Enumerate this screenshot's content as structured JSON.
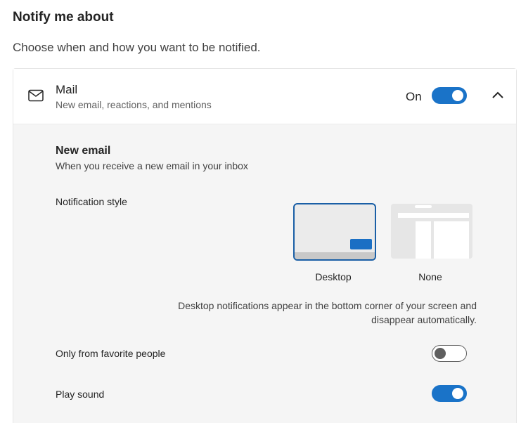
{
  "page": {
    "title": "Notify me about",
    "subtitle": "Choose when and how you want to be notified."
  },
  "mail": {
    "icon": "mail-icon",
    "title": "Mail",
    "description": "New email, reactions, and mentions",
    "status_label": "On",
    "enabled": true,
    "expand_icon": "chevron-up-icon"
  },
  "new_email": {
    "title": "New email",
    "description": "When you receive a new email in your inbox",
    "notification_style_label": "Notification style",
    "options": [
      {
        "label": "Desktop",
        "selected": true
      },
      {
        "label": "None",
        "selected": false
      }
    ],
    "info": "Desktop notifications appear in the bottom corner of your screen and disappear automatically."
  },
  "settings": [
    {
      "label": "Only from favorite people",
      "enabled": false
    },
    {
      "label": "Play sound",
      "enabled": true
    }
  ],
  "colors": {
    "accent": "#1a73c8",
    "selected_border": "#1a5fa6",
    "panel_background": "#f5f5f5"
  }
}
